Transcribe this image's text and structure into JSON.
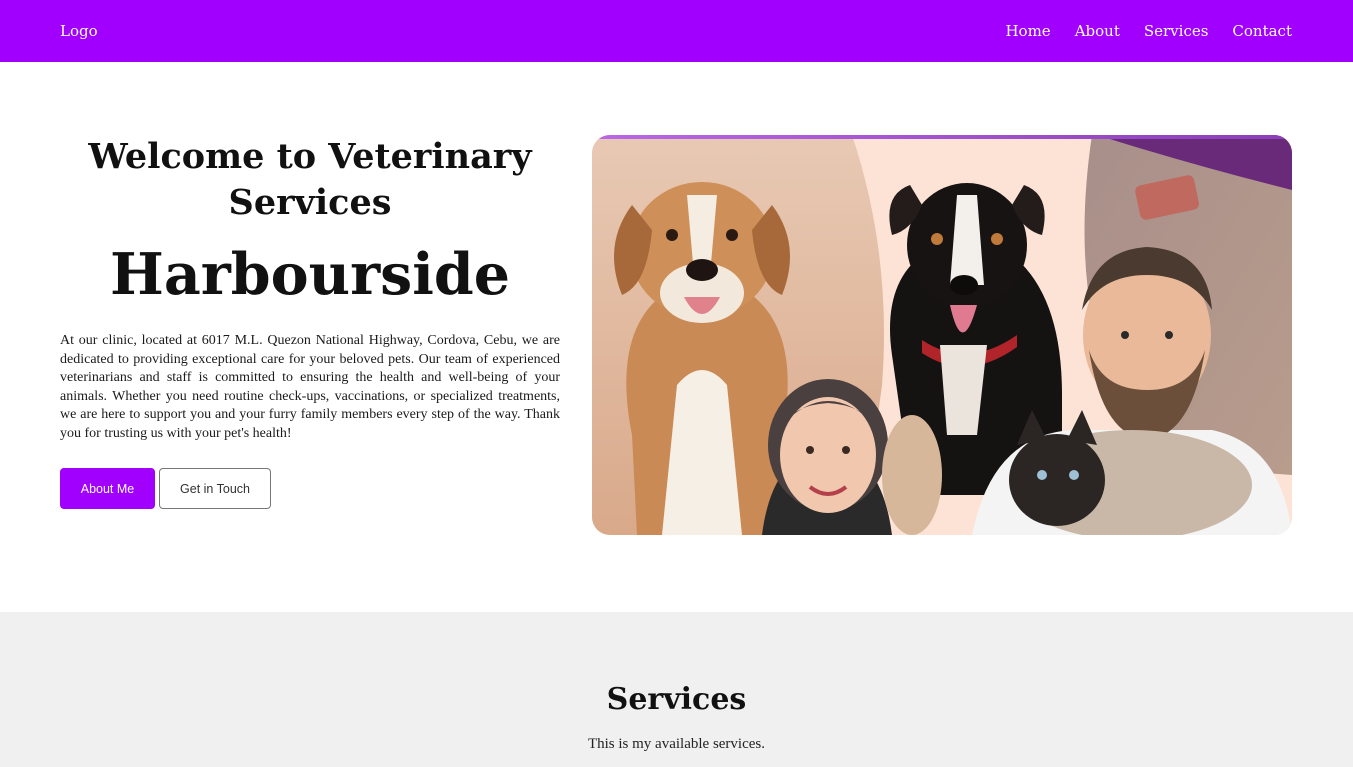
{
  "nav": {
    "logo": "Logo",
    "links": [
      "Home",
      "About",
      "Services",
      "Contact"
    ]
  },
  "hero": {
    "title": "Welcome to Veterinary Services",
    "brand": "Harbourside",
    "description": "At our clinic, located at 6017 M.L. Quezon National Highway, Cordova, Cebu, we are dedicated to providing exceptional care for your beloved pets. Our team of experienced veterinarians and staff is committed to ensuring the health and well-being of your animals. Whether you need routine check-ups, vaccinations, or specialized treatments, we are here to support you and your furry family members every step of the way. Thank you for trusting us with your pet's health!",
    "primary_button": "About Me",
    "secondary_button": "Get in Touch"
  },
  "services": {
    "title": "Services",
    "subtitle": "This is my available services."
  },
  "colors": {
    "brand": "#a100ff",
    "services_bg": "#f0f0f0"
  }
}
